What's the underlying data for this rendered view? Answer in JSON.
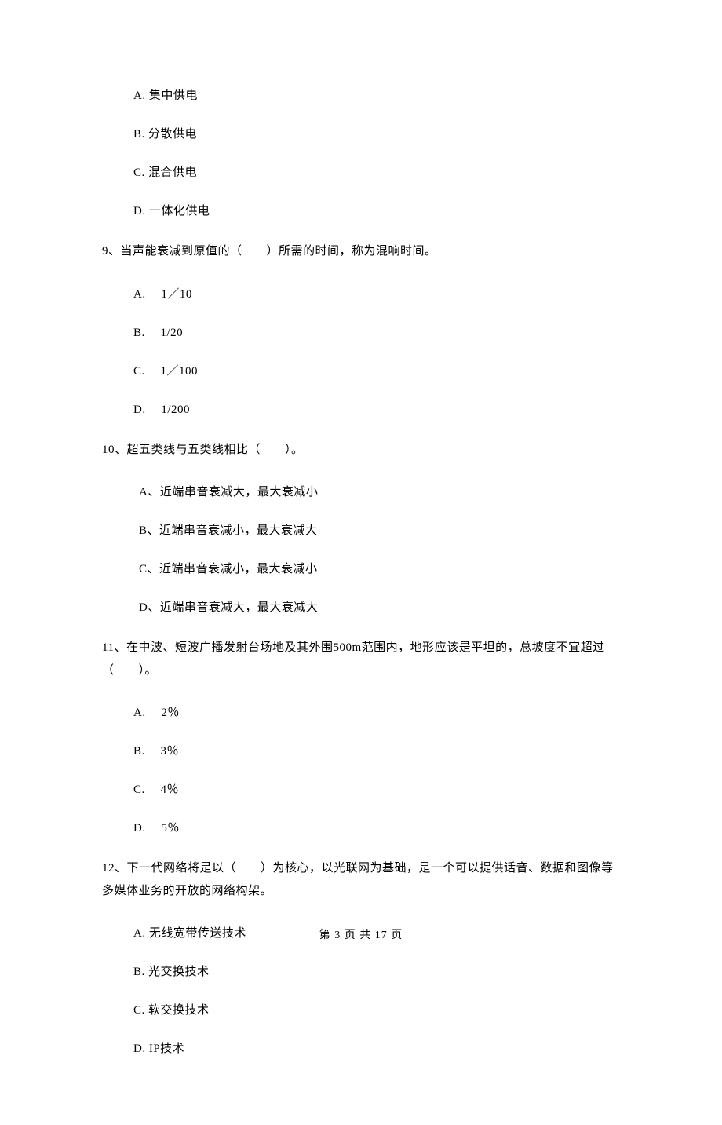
{
  "q8": {
    "options": {
      "a": "A.  集中供电",
      "b": "B.  分散供电",
      "c": "C.  混合供电",
      "d": "D.  一体化供电"
    }
  },
  "q9": {
    "stem": "9、当声能衰减到原值的（　　）所需的时间，称为混响时间。",
    "options": {
      "a": "A.　 1／10",
      "b": "B.　 1/20",
      "c": "C.　 1／100",
      "d": "D.　 1/200"
    }
  },
  "q10": {
    "stem": "10、超五类线与五类线相比（　　）。",
    "options": {
      "a": "A、近端串音衰减大，最大衰减小",
      "b": "B、近端串音衰减小，最大衰减大",
      "c": "C、近端串音衰减小，最大衰减小",
      "d": "D、近端串音衰减大，最大衰减大"
    }
  },
  "q11": {
    "stem": "11、在中波、短波广播发射台场地及其外围500m范围内，地形应该是平坦的，总坡度不宜超过（　　）。",
    "options": {
      "a": "A.　 2％",
      "b": "B.　 3％",
      "c": "C.　 4％",
      "d": "D.　 5％"
    }
  },
  "q12": {
    "stem": "12、下一代网络将是以（　　）为核心，以光联网为基础，是一个可以提供话音、数据和图像等多媒体业务的开放的网络构架。",
    "options": {
      "a": "A.  无线宽带传送技术",
      "b": "B.  光交换技术",
      "c": "C.  软交换技术",
      "d": "D.  IP技术"
    }
  },
  "footer": "第 3 页 共 17 页"
}
